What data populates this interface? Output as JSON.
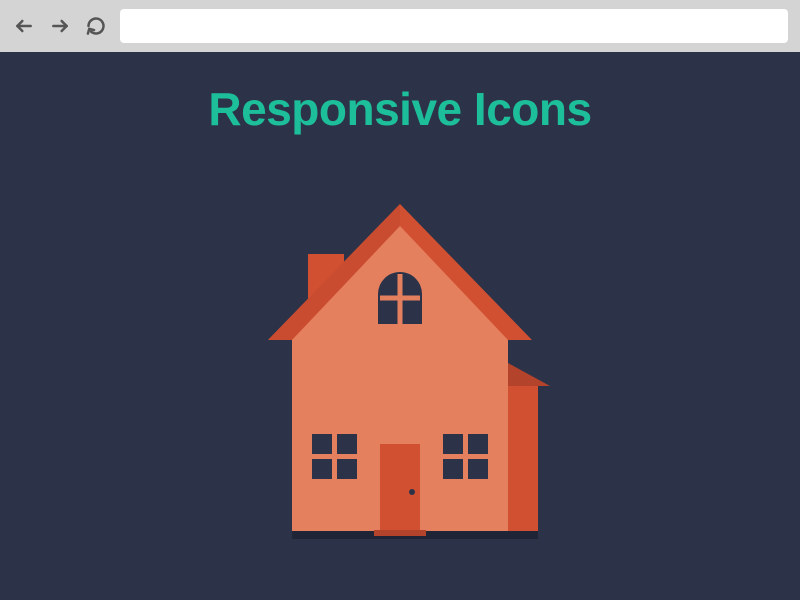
{
  "browser": {
    "back_label": "Back",
    "forward_label": "Forward",
    "refresh_label": "Refresh",
    "address_value": "",
    "address_placeholder": ""
  },
  "page": {
    "title": "Responsive Icons"
  },
  "icon": {
    "name": "house-illustration"
  },
  "colors": {
    "background": "#2c3348",
    "accent": "#1dbf9b",
    "house_light": "#e5805f",
    "house_dark": "#d15032",
    "window_dark": "#2c3348"
  }
}
